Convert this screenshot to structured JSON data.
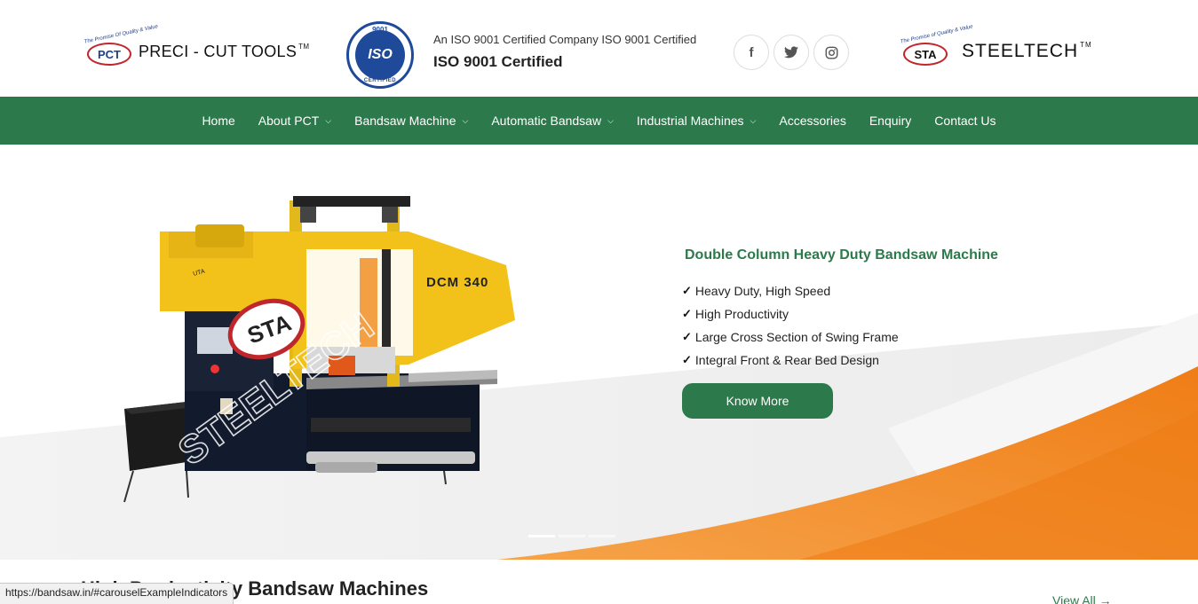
{
  "header": {
    "pct_logo": {
      "seal_text": "PCT",
      "arc_text": "The Promise Of Quality & Value",
      "brand": "PRECI - CUT TOOLS",
      "tm": "TM"
    },
    "iso_badge": {
      "top": "9001",
      "main": "ISO",
      "bottom": "CERTIFIED"
    },
    "iso_line1": "An ISO 9001 Certified Company ISO 9001 Certified",
    "iso_line2": "ISO 9001 Certified",
    "social": [
      {
        "icon": "facebook-icon",
        "glyph": "f"
      },
      {
        "icon": "twitter-icon",
        "glyph": "🐦"
      },
      {
        "icon": "instagram-icon",
        "glyph": "◎"
      }
    ],
    "sta_logo": {
      "seal_text": "STA",
      "arc_text": "The Promise of Quality & Value",
      "brand": "STEELTECH",
      "tm": "TM"
    }
  },
  "nav": {
    "items": [
      {
        "label": "Home",
        "dropdown": false
      },
      {
        "label": "About PCT",
        "dropdown": true
      },
      {
        "label": "Bandsaw Machine",
        "dropdown": true
      },
      {
        "label": "Automatic Bandsaw",
        "dropdown": true
      },
      {
        "label": "Industrial Machines",
        "dropdown": true
      },
      {
        "label": "Accessories",
        "dropdown": false
      },
      {
        "label": "Enquiry",
        "dropdown": false
      },
      {
        "label": "Contact Us",
        "dropdown": false
      }
    ],
    "chevron": "⌄"
  },
  "hero": {
    "title": "Double Column Heavy Duty Bandsaw Machine",
    "features": [
      "Heavy Duty, High Speed",
      "High Productivity",
      "Large Cross Section of Swing Frame",
      "Integral Front & Rear Bed Design"
    ],
    "check": "✓",
    "button": "Know More",
    "machine_label": "DCM 340",
    "machine_badge": "STA",
    "watermark": "STEELTECH",
    "panel_label": "UTA",
    "colors": {
      "accent": "#2c7a4b",
      "orange": "#f08a1c",
      "machine_yellow": "#f2c21b"
    }
  },
  "section": {
    "title": "High Productivity Bandsaw Machines",
    "view_all": "View All →"
  },
  "status_url": "https://bandsaw.in/#carouselExampleIndicators"
}
